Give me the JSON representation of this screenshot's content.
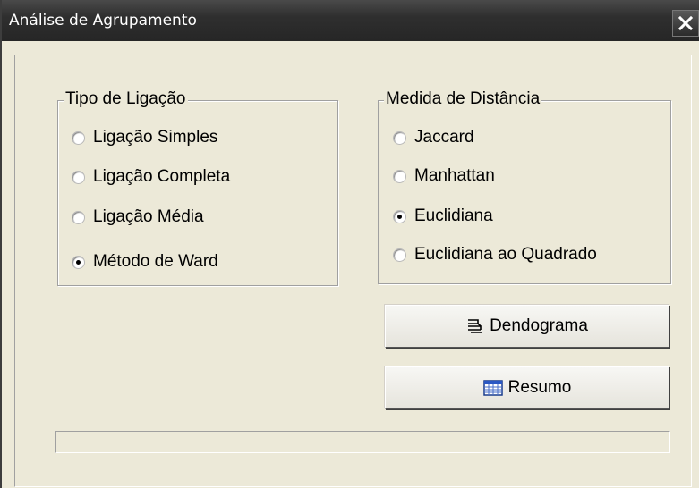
{
  "window": {
    "title": "Análise de Agrupamento"
  },
  "linkage_group": {
    "title": "Tipo de Ligação",
    "options": [
      {
        "label": "Ligação Simples",
        "checked": false
      },
      {
        "label": "Ligação Completa",
        "checked": false
      },
      {
        "label": "Ligação Média",
        "checked": false
      },
      {
        "label": "Método de Ward",
        "checked": true
      }
    ]
  },
  "distance_group": {
    "title": "Medida de Distância",
    "options": [
      {
        "label": "Jaccard",
        "checked": false
      },
      {
        "label": "Manhattan",
        "checked": false
      },
      {
        "label": "Euclidiana",
        "checked": true
      },
      {
        "label": "Euclidiana ao Quadrado",
        "checked": false
      }
    ]
  },
  "buttons": {
    "dendrogram_label": "Dendograma",
    "summary_label": "Resumo"
  },
  "progress": {
    "value": 0
  },
  "icons": {
    "close": "close-icon",
    "dendrogram": "dendrogram-icon",
    "summary": "table-icon"
  }
}
